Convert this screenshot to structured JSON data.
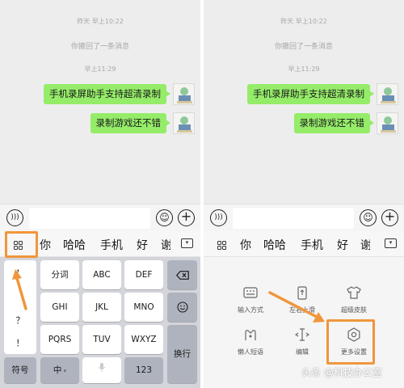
{
  "colors": {
    "bubble": "#95ec69",
    "highlight": "#f0963b",
    "chat_bg": "#ededed",
    "keyboard_bg": "#d3d5db"
  },
  "chat": {
    "timestamp_1": "昨天 早上10:22",
    "recall_notice": "你撤回了一条消息",
    "timestamp_2": "早上11:29",
    "messages": [
      "手机录屏助手支持超清录制",
      "录制游戏还不错"
    ]
  },
  "input_bar": {
    "voice_icon": "voice-icon",
    "emoji_icon": "emoji-icon",
    "plus_icon": "plus-icon"
  },
  "candidates": [
    "你",
    "哈哈",
    "手机",
    "好",
    "谢"
  ],
  "keyboard": {
    "punctuation": [
      "，",
      "？",
      "！"
    ],
    "row1": [
      "分词",
      "ABC",
      "DEF"
    ],
    "row2": [
      "GHI",
      "JKL",
      "MNO"
    ],
    "row3": [
      "PQRS",
      "TUV",
      "WXYZ"
    ],
    "bottom": {
      "symbols": "符号",
      "chinese": "中",
      "numbers": "123"
    },
    "enter": "换行"
  },
  "more_panel": {
    "tools": [
      {
        "label": "输入方式",
        "icon": "keyboard-icon"
      },
      {
        "label": "左右上滑",
        "icon": "swipe-icon"
      },
      {
        "label": "超级皮肤",
        "icon": "shirt-icon"
      },
      {
        "label": "懒人短语",
        "icon": "quick-phrase-icon"
      },
      {
        "label": "编辑",
        "icon": "cursor-edit-icon"
      },
      {
        "label": "更多设置",
        "icon": "gear-icon"
      }
    ]
  },
  "watermark": "头条 @科技办公室"
}
